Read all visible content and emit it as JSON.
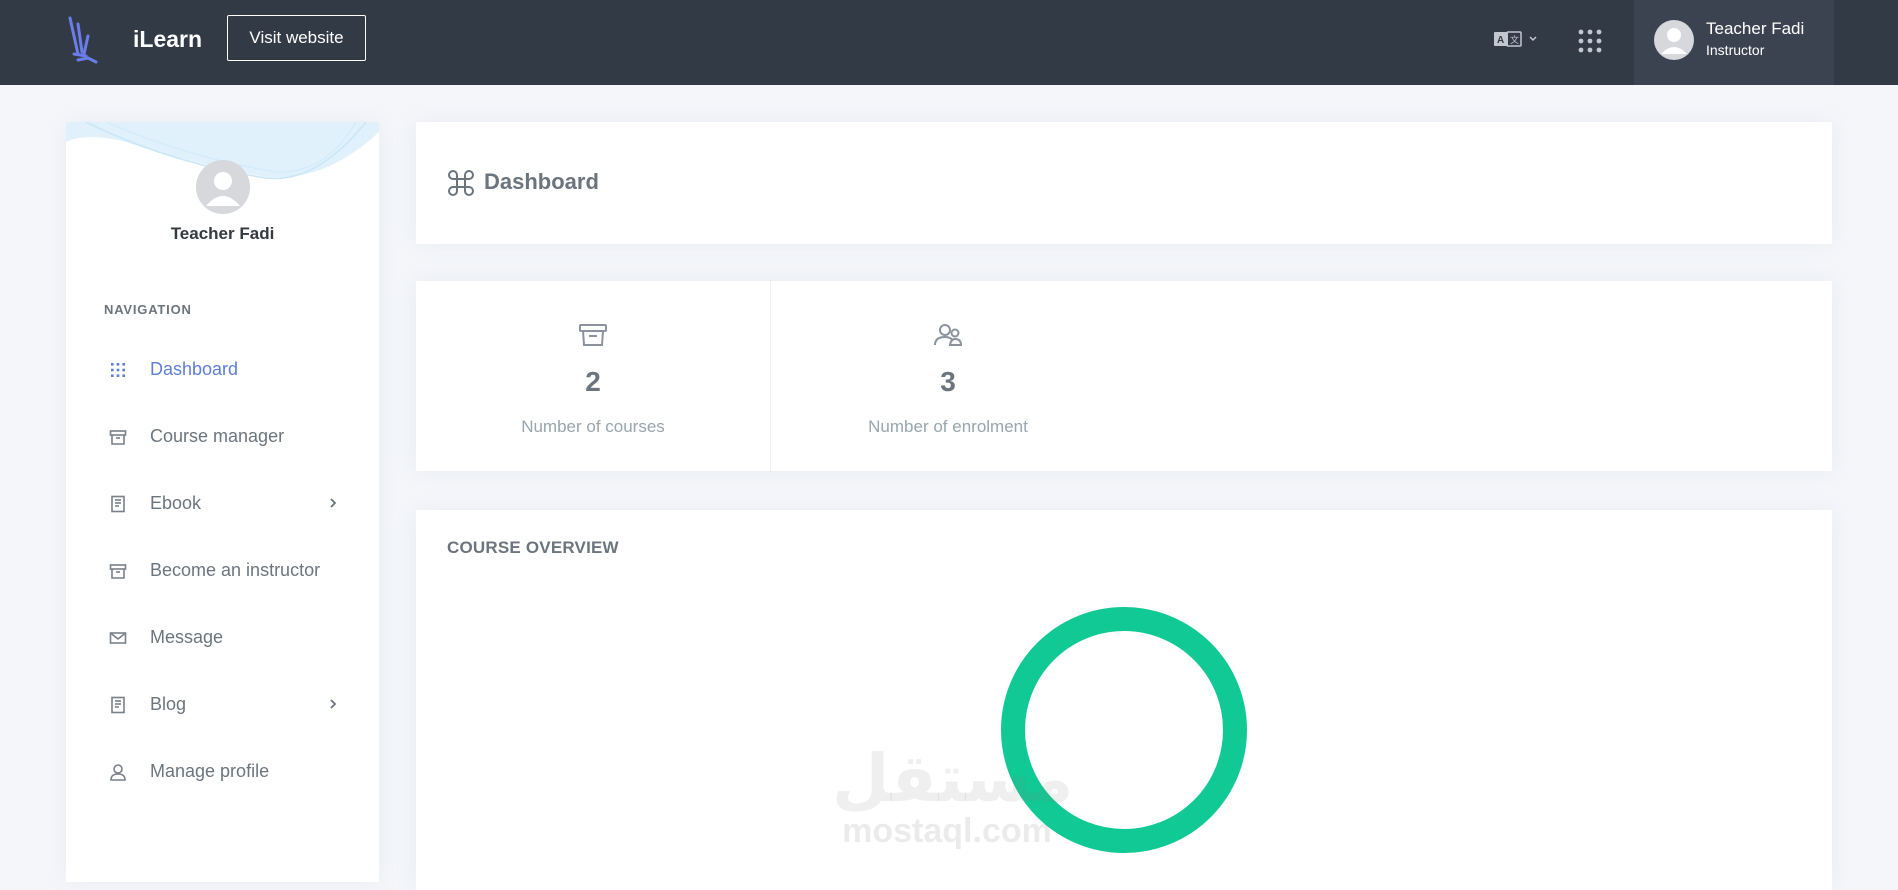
{
  "header": {
    "brand": "iLearn",
    "visit_label": "Visit website",
    "user_name": "Teacher Fadi",
    "user_role": "Instructor",
    "icons": {
      "logo": "ilearn-logo",
      "language": "translate-icon",
      "apps": "apps-grid-icon",
      "avatar": "avatar"
    }
  },
  "sidebar": {
    "user_name": "Teacher Fadi",
    "nav_title": "NAVIGATION",
    "items": [
      {
        "label": "Dashboard",
        "icon": "grid-icon",
        "active": true,
        "has_children": false
      },
      {
        "label": "Course manager",
        "icon": "archive-icon",
        "active": false,
        "has_children": false
      },
      {
        "label": "Ebook",
        "icon": "book-icon",
        "active": false,
        "has_children": true
      },
      {
        "label": "Become an instructor",
        "icon": "archive-icon",
        "active": false,
        "has_children": false
      },
      {
        "label": "Message",
        "icon": "mail-icon",
        "active": false,
        "has_children": false
      },
      {
        "label": "Blog",
        "icon": "book-icon",
        "active": false,
        "has_children": true
      },
      {
        "label": "Manage profile",
        "icon": "user-icon",
        "active": false,
        "has_children": false
      }
    ]
  },
  "main": {
    "page_title": "Dashboard",
    "stats": [
      {
        "value": "2",
        "label": "Number of courses",
        "icon": "archive-icon"
      },
      {
        "value": "3",
        "label": "Number of enrolment",
        "icon": "users-icon"
      }
    ],
    "overview_title": "COURSE OVERVIEW"
  },
  "chart_data": {
    "type": "pie",
    "title": "",
    "categories": [
      ""
    ],
    "values": [
      100
    ]
  },
  "watermark": {
    "arabic": "مستقل",
    "latin": "mostaql.com"
  },
  "colors": {
    "topbar": "#323a46",
    "active": "#5f7ed6",
    "donut": "#10c995",
    "background": "#f4f6fa"
  }
}
